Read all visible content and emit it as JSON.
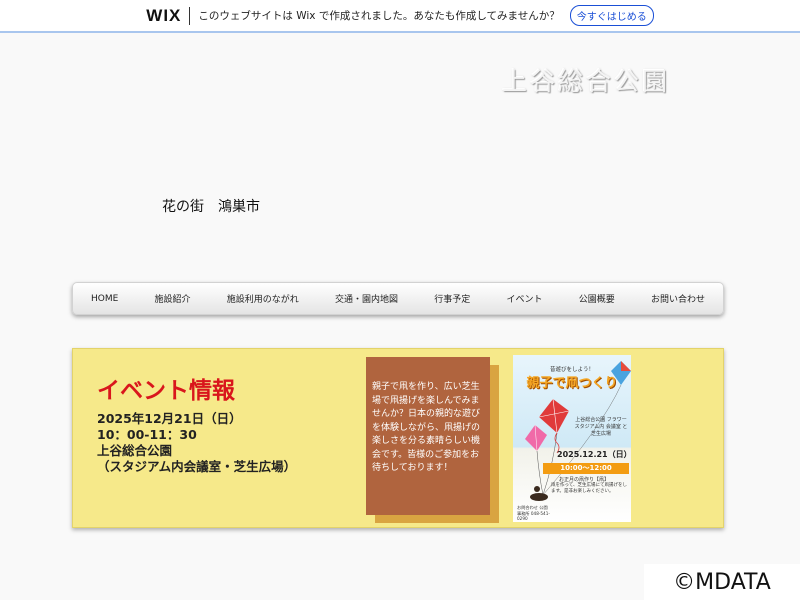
{
  "wix_banner": {
    "logo": "WIX",
    "message": "このウェブサイトは Wix で作成されました。あなたも作成してみませんか？",
    "cta_label": "今すぐはじめる"
  },
  "header": {
    "site_logo": "上谷総合公園",
    "tagline": "花の街　鴻巣市"
  },
  "nav": {
    "items": [
      {
        "label": "HOME"
      },
      {
        "label": "施設紹介"
      },
      {
        "label": "施設利用のながれ"
      },
      {
        "label": "交通・園内地図"
      },
      {
        "label": "行事予定"
      },
      {
        "label": "イベント"
      },
      {
        "label": "公園概要"
      },
      {
        "label": "お問い合わせ"
      }
    ]
  },
  "event": {
    "heading": "イベント情報",
    "date": "2025年12月21日（日）",
    "time": "10：00-11：30",
    "venue": "上谷総合公園",
    "room": "（スタジアム内会議室・芝生広場）",
    "description": "親子で凧を作り、広い芝生場で凧揚げを楽しんでみませんか？日本の親的な遊びを体験しながら、凧揚げの楽しさを分る素晴らしい機会です。皆様のご参加をお待ちしております！"
  },
  "poster": {
    "subtitle": "昔遊びをしよう！",
    "title": "親子で凧つくり",
    "venue": "上谷総合公園 フラワースタジアム内 会議室 と 芝生広場",
    "date": "2025.12.21（日）",
    "time": "10:00〜12:00",
    "note": "お正月の凧作り【凧】",
    "body": "凧を作って、芝生広場にて凧揚げをします。是非お楽しみください。",
    "contact": "お問合わせ 公園事務所 048-541-0290"
  },
  "colors": {
    "event_bg": "#f6e98a",
    "heading_red": "#d9161c",
    "desc_box": "#b0643e",
    "desc_shadow": "#d9a441"
  },
  "watermark": "©MDATA"
}
